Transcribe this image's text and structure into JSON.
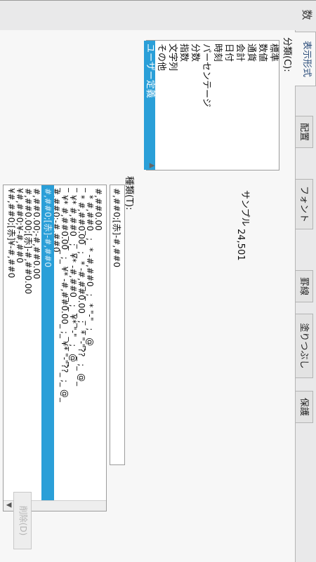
{
  "window": {
    "title_char": "数"
  },
  "tabs": [
    {
      "label": "表示形式",
      "active": true
    },
    {
      "label": "配置",
      "active": false
    },
    {
      "label": "フォント",
      "active": false
    },
    {
      "label": "罫線",
      "active": false
    },
    {
      "label": "塗りつぶし",
      "active": false
    },
    {
      "label": "保護",
      "active": false
    }
  ],
  "category": {
    "label": "分類(C):",
    "items": [
      "標準",
      "数値",
      "通貨",
      "会計",
      "日付",
      "時刻",
      "パーセンテージ",
      "分数",
      "指数",
      "文字列",
      "その他",
      "ユーザー定義"
    ],
    "selected_index": 11
  },
  "sample": {
    "label": "サンプル",
    "value": "24,501"
  },
  "type": {
    "label": "種類(T):",
    "value": "#,##0;[赤]-#,##0"
  },
  "format_list": {
    "items": [
      "#,##0.00",
      "_ * #,##0_ ;_ * -#,##0_ ;_ * \"-\"_ ;_ @_",
      "_ * #,##0.00_ ;_ * -#,##0.00_ ;_ * \"-\"??_ ;_ @_",
      "_ ¥* #,##0_ ;_ ¥* -#,##0_ ;_ ¥* \"-\"_ ;_ @_",
      "_ ¥* #,##0.00_ ;_ ¥* -#,##0.00_ ;_ ¥* \"-\"??_ ;_ @_",
      "#,##0;-#,##0",
      "#,##0;[赤]-#,##0",
      "#,##0.00;-#,##0.00",
      "#,##0.00;[赤]-#,##0.00",
      "¥#,##0;¥-#,##0",
      "¥#,##0;[赤]¥-#,##0"
    ],
    "selected_index": 6
  },
  "delete_button": {
    "label": "削除(D)"
  }
}
